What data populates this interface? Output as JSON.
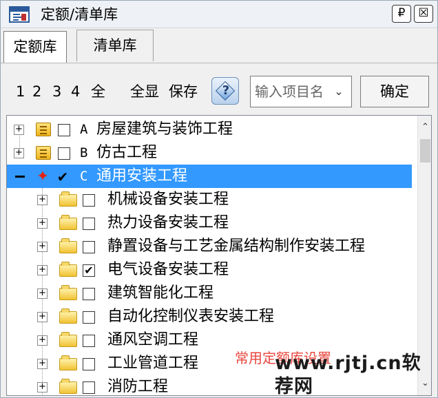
{
  "window": {
    "title": "定额/清单库",
    "pin_glyph": "₽",
    "close_glyph": "☒"
  },
  "tabs": [
    {
      "label": "定额库",
      "active": true
    },
    {
      "label": "清单库",
      "active": false
    }
  ],
  "toolbar": {
    "level1": "1",
    "level2": "2",
    "level3": "3",
    "level4": "4",
    "all": "全",
    "show_all": "全显",
    "save": "保存",
    "help_glyph": "?",
    "search_placeholder": "输入项目名",
    "confirm": "确定"
  },
  "tree": {
    "items": [
      {
        "letter": "A",
        "label": "房屋建筑与装饰工程",
        "checked": false,
        "expanded": false,
        "level": 0
      },
      {
        "letter": "B",
        "label": "仿古工程",
        "checked": false,
        "expanded": false,
        "level": 0
      },
      {
        "letter": "C",
        "label": "通用安装工程",
        "checked": true,
        "expanded": true,
        "level": 0,
        "selected": true
      },
      {
        "label": "机械设备安装工程",
        "checked": false,
        "level": 1
      },
      {
        "label": "热力设备安装工程",
        "checked": false,
        "level": 1
      },
      {
        "label": "静置设备与工艺金属结构制作安装工程",
        "checked": false,
        "level": 1
      },
      {
        "label": "电气设备安装工程",
        "checked": true,
        "level": 1
      },
      {
        "label": "建筑智能化工程",
        "checked": false,
        "level": 1
      },
      {
        "label": "自动化控制仪表安装工程",
        "checked": false,
        "level": 1
      },
      {
        "label": "通风空调工程",
        "checked": false,
        "level": 1
      },
      {
        "label": "工业管道工程",
        "checked": false,
        "level": 1
      },
      {
        "label": "消防工程",
        "checked": false,
        "level": 1
      }
    ],
    "check_mark": "✔",
    "expand_glyph": "+",
    "scroll_up": "⌃",
    "scroll_down": "⌄"
  },
  "watermark": {
    "note": "常用定额库设置",
    "site": "www.rjtj.cn软荐网"
  },
  "colors": {
    "selection": "#3399ff",
    "note_red": "#e8453c",
    "node_red": "#e2231a"
  }
}
